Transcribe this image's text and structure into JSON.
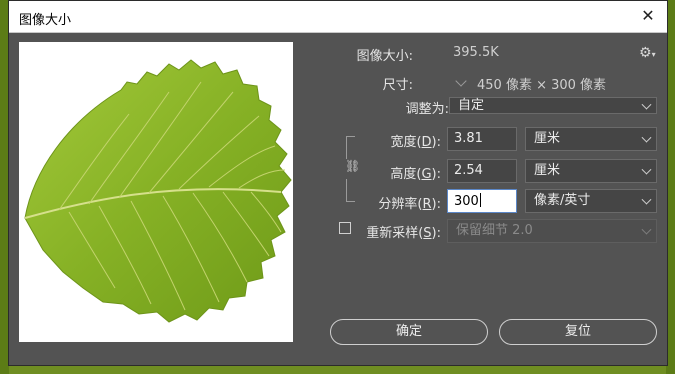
{
  "dialog": {
    "title": "图像大小",
    "close_glyph": "✕"
  },
  "info": {
    "image_size_label": "图像大小:",
    "image_size_value": "395.5K",
    "dimensions_label": "尺寸:",
    "dimensions_value": "450 像素 × 300 像素"
  },
  "form": {
    "fit_to_label": "调整为:",
    "fit_to_value": "自定",
    "width_label_pre": "宽度(",
    "width_label_key": "D",
    "width_label_post": "):",
    "width_value": "3.81",
    "width_unit": "厘米",
    "height_label_pre": "高度(",
    "height_label_key": "G",
    "height_label_post": "):",
    "height_value": "2.54",
    "height_unit": "厘米",
    "resolution_label_pre": "分辨率(",
    "resolution_label_key": "R",
    "resolution_label_post": "):",
    "resolution_value": "300",
    "resolution_unit": "像素/英寸",
    "resample_label_pre": "重新采样(",
    "resample_label_key": "S",
    "resample_label_post": "):",
    "resample_checked": false,
    "resample_method": "保留细节 2.0"
  },
  "buttons": {
    "ok": "确定",
    "reset": "复位"
  },
  "icons": {
    "settings": "gear-icon",
    "constrain": "link-icon",
    "close": "close-icon"
  },
  "colors": {
    "dialog_bg": "#535353",
    "leaf_fill": "#8ab62a",
    "focus_border": "#5b87c8"
  }
}
